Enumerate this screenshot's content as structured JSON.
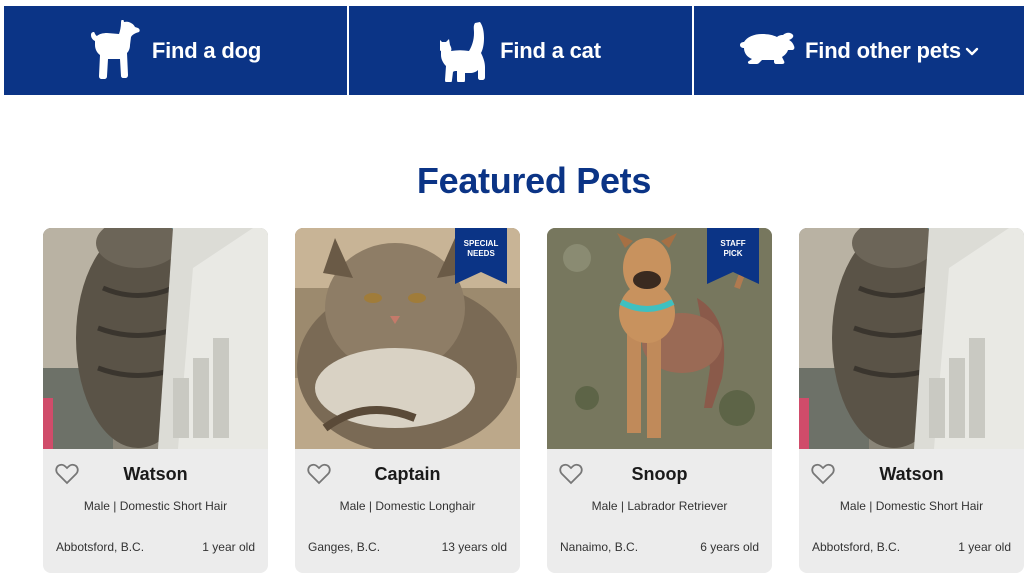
{
  "nav": {
    "items": [
      {
        "label": "Find a dog",
        "icon": "dog-icon"
      },
      {
        "label": "Find a cat",
        "icon": "cat-icon"
      },
      {
        "label": "Find other pets",
        "icon": "rabbit-icon",
        "dropdown": true
      }
    ]
  },
  "featured": {
    "title": "Featured Pets",
    "pets": [
      {
        "name": "Watson",
        "description": "Male | Domestic Short Hair",
        "location": "Abbotsford, B.C.",
        "age": "1 year old",
        "ribbon": ""
      },
      {
        "name": "Captain",
        "description": "Male | Domestic Longhair",
        "location": "Ganges, B.C.",
        "age": "13 years old",
        "ribbon_line1": "SPECIAL",
        "ribbon_line2": "NEEDS"
      },
      {
        "name": "Snoop",
        "description": "Male | Labrador Retriever",
        "location": "Nanaimo, B.C.",
        "age": "6 years old",
        "ribbon_line1": "STAFF",
        "ribbon_line2": "PICK"
      },
      {
        "name": "Watson",
        "description": "Male | Domestic Short Hair",
        "location": "Abbotsford, B.C.",
        "age": "1 year old",
        "ribbon": ""
      }
    ]
  },
  "colors": {
    "brand": "#0b3486",
    "card_bg": "#ececec",
    "white": "#ffffff"
  }
}
